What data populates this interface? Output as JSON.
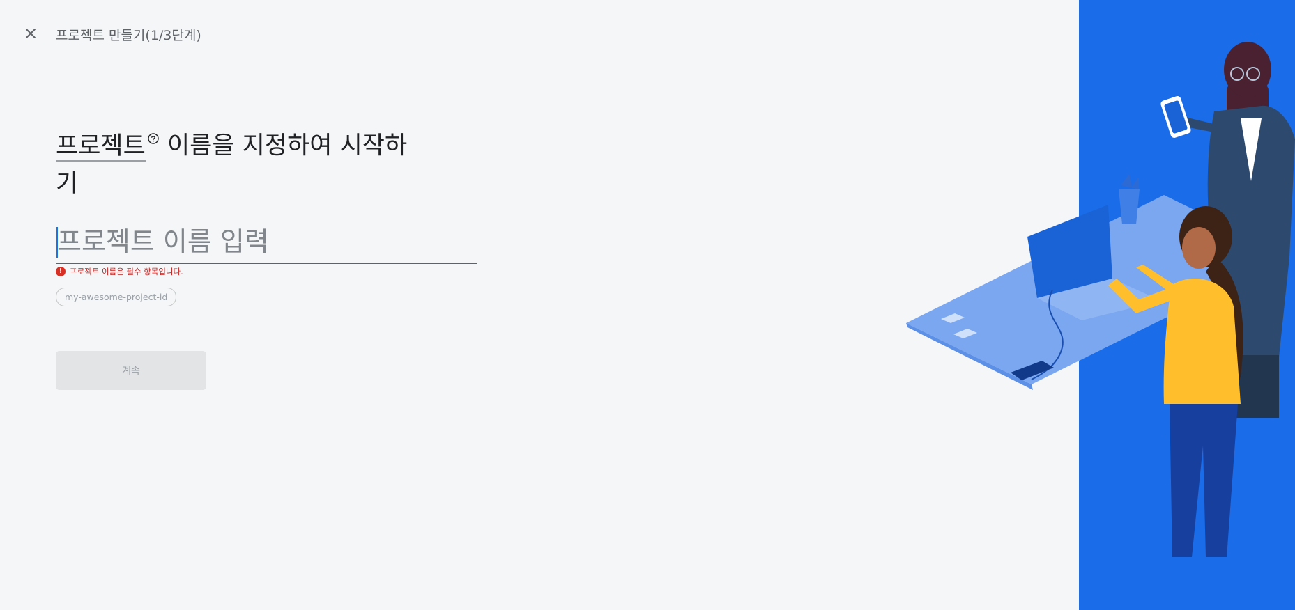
{
  "header": {
    "close_icon": "close-icon",
    "step_title": "프로젝트 만들기(1/3단계)"
  },
  "main": {
    "headline_term": "프로젝트",
    "headline_rest": "이름을 지정하여 시작하기",
    "help_icon": "help-circle-icon",
    "name_input": {
      "placeholder": "프로젝트 이름 입력",
      "value": ""
    },
    "error": {
      "icon": "error-icon",
      "glyph": "!",
      "message": "프로젝트 이름은 필수 항목입니다."
    },
    "project_id_chip": "my-awesome-project-id",
    "continue_label": "계속"
  },
  "colors": {
    "background": "#f4f6f8",
    "panel_blue": "#1a6ce8",
    "error_red": "#d93025",
    "button_disabled": "#e3e4e6"
  }
}
